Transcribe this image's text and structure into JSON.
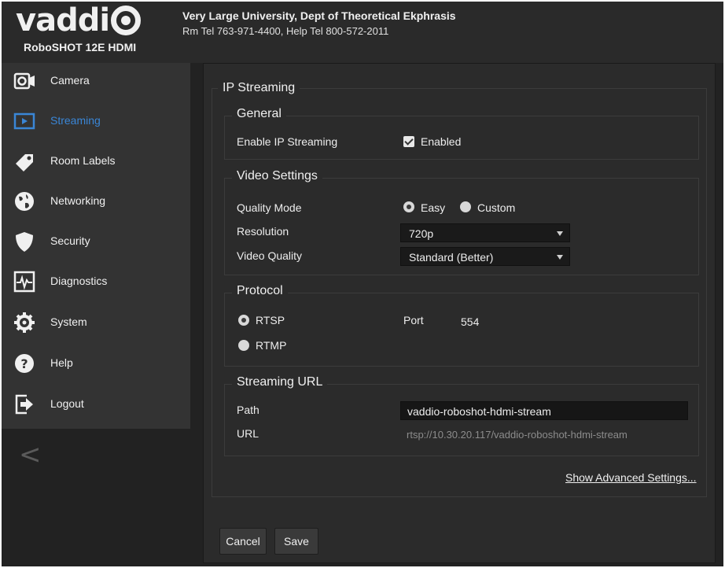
{
  "header": {
    "logo_text": "vaddio",
    "model": "RoboSHOT 12E HDMI",
    "organization": "Very Large University, Dept of Theoretical Ekphrasis",
    "phones": "Rm Tel 763-971-4400, Help Tel 800-572-2011"
  },
  "sidebar": {
    "active_color": "#3a86d6",
    "items": [
      {
        "label": "Camera",
        "icon": "camera-icon"
      },
      {
        "label": "Streaming",
        "icon": "play-icon"
      },
      {
        "label": "Room Labels",
        "icon": "tag-icon"
      },
      {
        "label": "Networking",
        "icon": "globe-icon"
      },
      {
        "label": "Security",
        "icon": "shield-icon"
      },
      {
        "label": "Diagnostics",
        "icon": "pulse-icon"
      },
      {
        "label": "System",
        "icon": "gear-icon"
      },
      {
        "label": "Help",
        "icon": "question-icon"
      },
      {
        "label": "Logout",
        "icon": "logout-icon"
      }
    ],
    "collapse_glyph": "<"
  },
  "ip_streaming": {
    "title": "IP Streaming",
    "general": {
      "title": "General",
      "enable_label": "Enable IP Streaming",
      "enable_value": "Enabled",
      "enabled": true
    },
    "video": {
      "title": "Video Settings",
      "quality_mode_label": "Quality Mode",
      "quality_mode_options": [
        "Easy",
        "Custom"
      ],
      "quality_mode_selected": "Easy",
      "resolution_label": "Resolution",
      "resolution_value": "720p",
      "video_quality_label": "Video Quality",
      "video_quality_value": "Standard (Better)"
    },
    "protocol": {
      "title": "Protocol",
      "options": [
        "RTSP",
        "RTMP"
      ],
      "selected": "RTSP",
      "port_label": "Port",
      "port_value": "554"
    },
    "streaming_url": {
      "title": "Streaming URL",
      "path_label": "Path",
      "path_value": "vaddio-roboshot-hdmi-stream",
      "url_label": "URL",
      "url_value": "rtsp://10.30.20.117/vaddio-roboshot-hdmi-stream"
    },
    "advanced_link": "Show Advanced Settings..."
  },
  "actions": {
    "cancel": "Cancel",
    "save": "Save"
  }
}
